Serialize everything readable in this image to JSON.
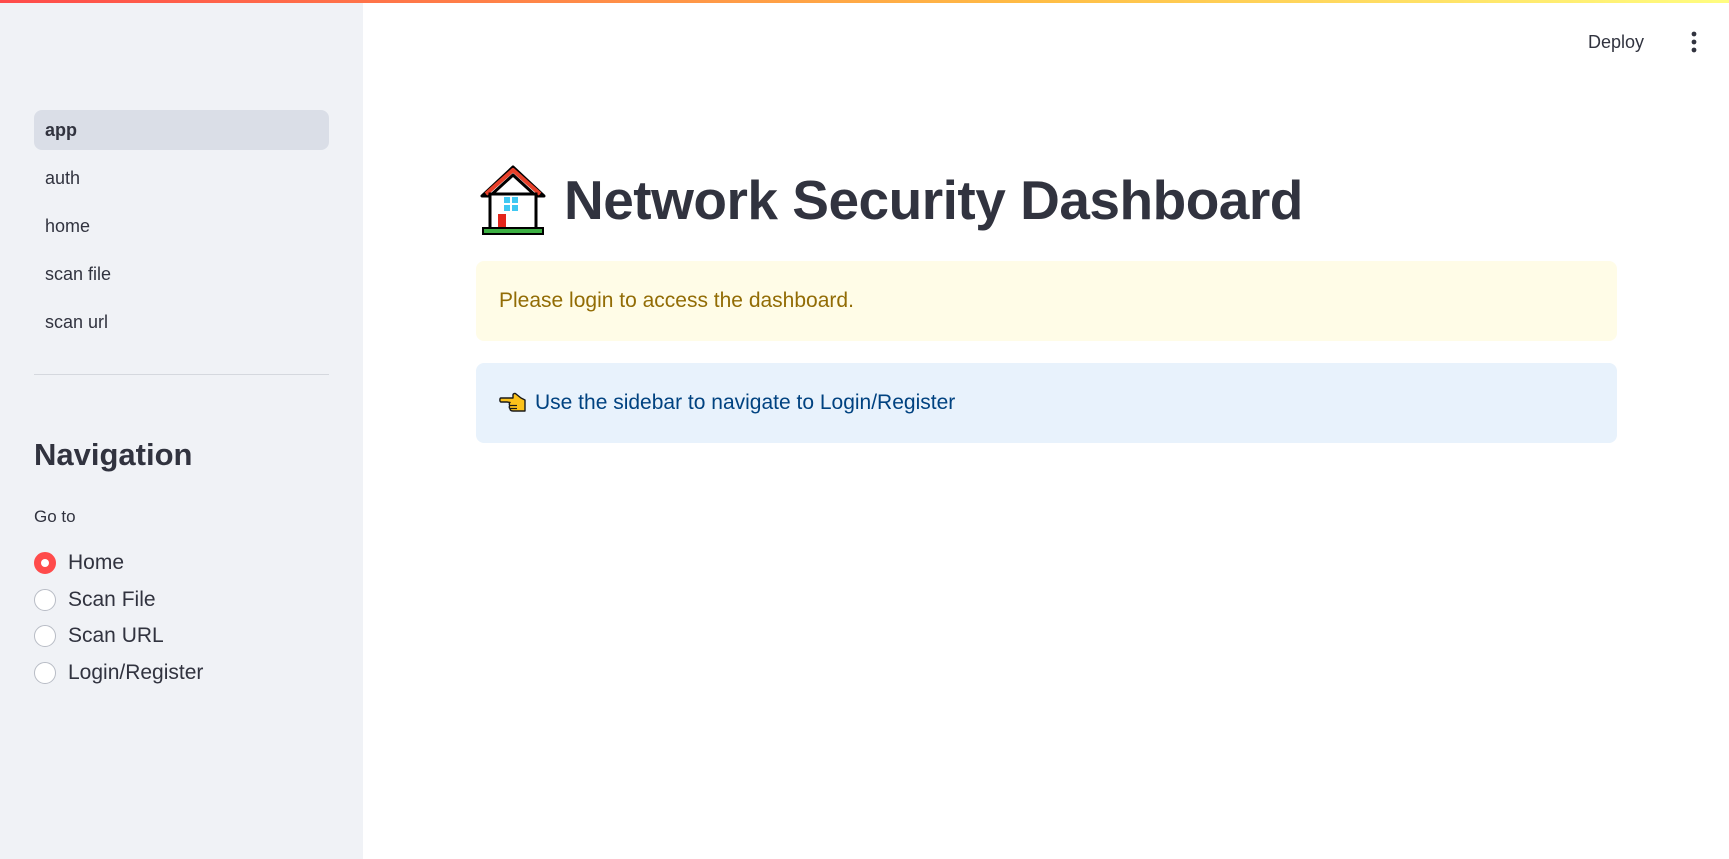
{
  "sidebar": {
    "pages": [
      {
        "label": "app",
        "active": true
      },
      {
        "label": "auth",
        "active": false
      },
      {
        "label": "home",
        "active": false
      },
      {
        "label": "scan file",
        "active": false
      },
      {
        "label": "scan url",
        "active": false
      }
    ],
    "heading": "Navigation",
    "radio_label": "Go to",
    "radio_options": [
      {
        "label": "Home",
        "selected": true
      },
      {
        "label": "Scan File",
        "selected": false
      },
      {
        "label": "Scan URL",
        "selected": false
      },
      {
        "label": "Login/Register",
        "selected": false
      }
    ]
  },
  "header": {
    "deploy_label": "Deploy",
    "menu_icon": "vertical-ellipsis-icon"
  },
  "main": {
    "title": "Network Security Dashboard",
    "title_icon": "house-icon",
    "warning_text": "Please login to access the dashboard.",
    "info_text": "Use the sidebar to navigate to Login/Register",
    "info_icon": "pointing-left-hand-icon"
  },
  "colors": {
    "accent": "#ff4b4b",
    "sidebar_bg": "#f0f2f6",
    "warning_bg": "#fffce7",
    "warning_text": "#926c05",
    "info_bg": "#e8f2fc",
    "info_text": "#004280"
  }
}
